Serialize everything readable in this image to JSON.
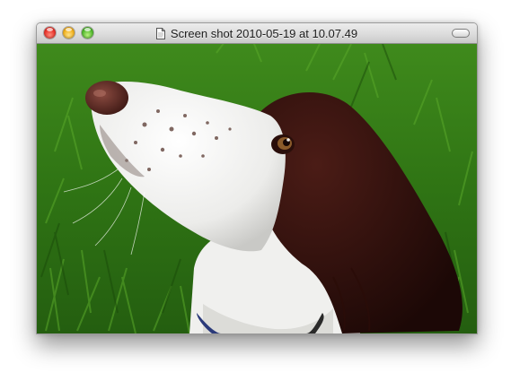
{
  "window": {
    "title": "Screen shot 2010-05-19 at 10.07.49",
    "title_icon": "document-icon",
    "controls": {
      "close": "close-button",
      "minimize": "minimize-button",
      "zoom": "zoom-button",
      "toolbar_toggle": "toolbar-toggle-button"
    }
  },
  "content": {
    "subject": "photo",
    "colors": {
      "grass_dark": "#1f4f0f",
      "grass_light": "#4f9a24",
      "fur_white": "#f2f2f0",
      "fur_brown": "#3a1410",
      "nose": "#5a2a22"
    }
  }
}
